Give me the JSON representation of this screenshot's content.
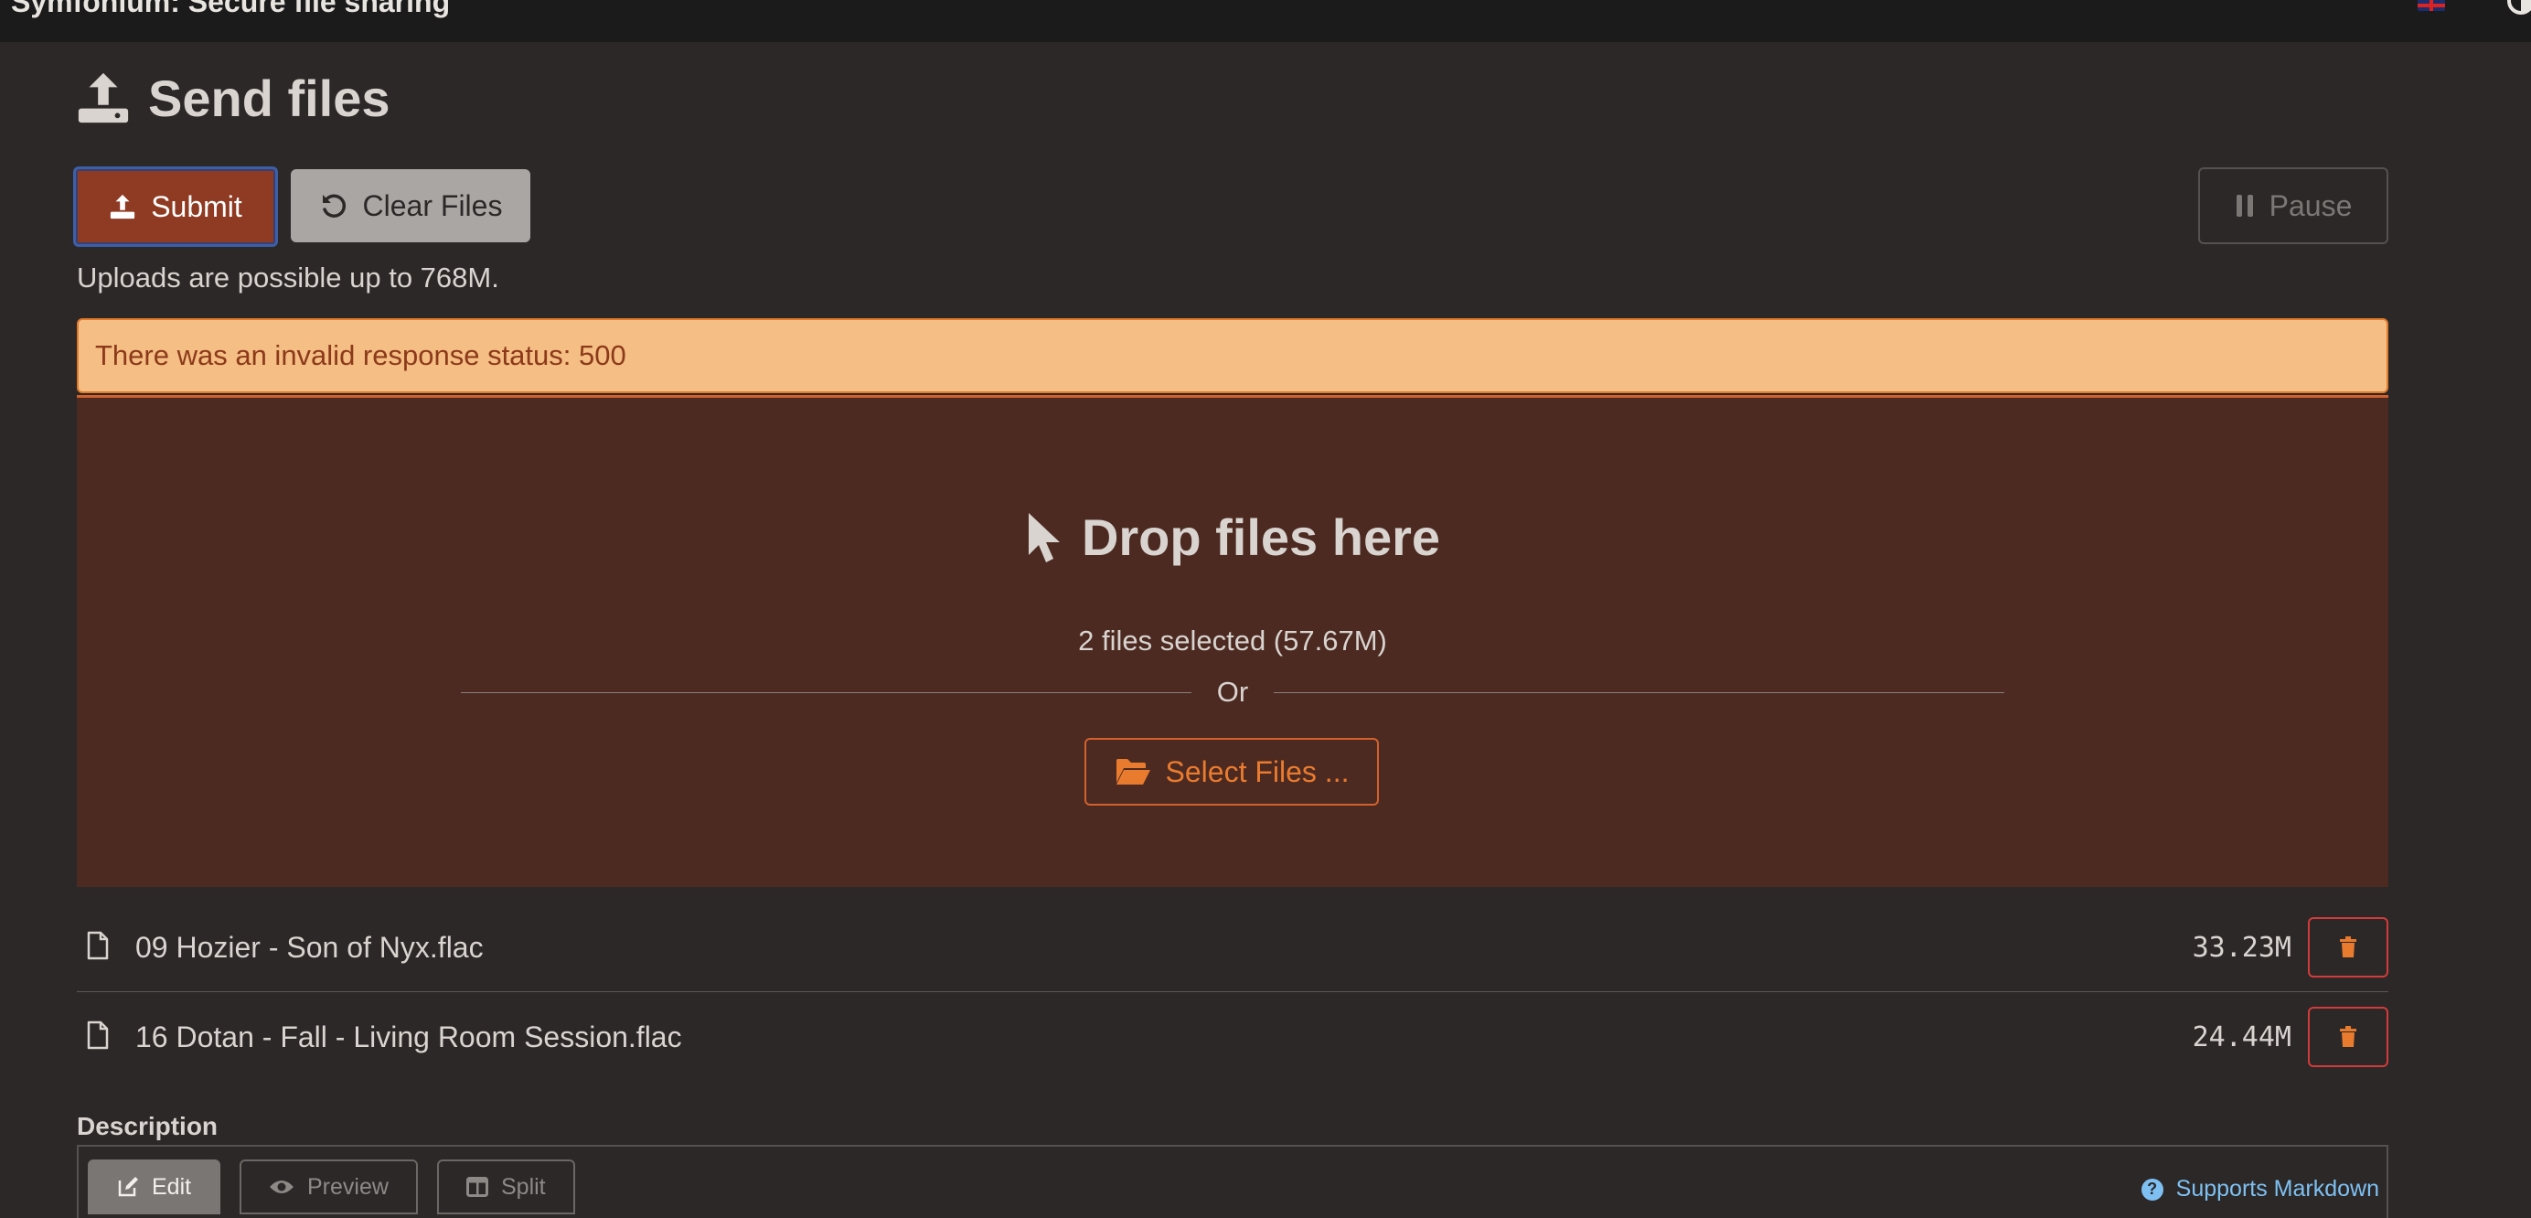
{
  "navbar": {
    "title": "Symfonium: Secure file sharing",
    "flag_icon": "uk-flag-icon",
    "theme_icon": "theme-toggle-icon"
  },
  "heading": {
    "title": "Send files",
    "icon": "upload-icon"
  },
  "toolbar": {
    "submit_label": "Submit",
    "clear_label": "Clear Files",
    "pause_label": "Pause"
  },
  "upload_limit_text": "Uploads are possible up to 768M.",
  "alert": {
    "message": "There was an invalid response status: 500"
  },
  "dropzone": {
    "title": "Drop files here",
    "selected_text": "2 files selected (57.67M)",
    "or_text": "Or",
    "select_label": "Select Files ..."
  },
  "files": [
    {
      "name": "09 Hozier - Son of Nyx.flac",
      "size": "33.23M"
    },
    {
      "name": "16 Dotan - Fall - Living Room Session.flac",
      "size": "24.44M"
    }
  ],
  "description": {
    "label": "Description",
    "tabs": {
      "edit": "Edit",
      "preview": "Preview",
      "split": "Split"
    },
    "markdown_hint": "Supports Markdown"
  },
  "colors": {
    "accent": "#d2612c",
    "submit_bg": "#8f3a22",
    "alert_bg": "#f4be84",
    "dropzone_bg": "#4c2a21",
    "delete_border": "#d13b3b",
    "link": "#7fc0f2"
  }
}
